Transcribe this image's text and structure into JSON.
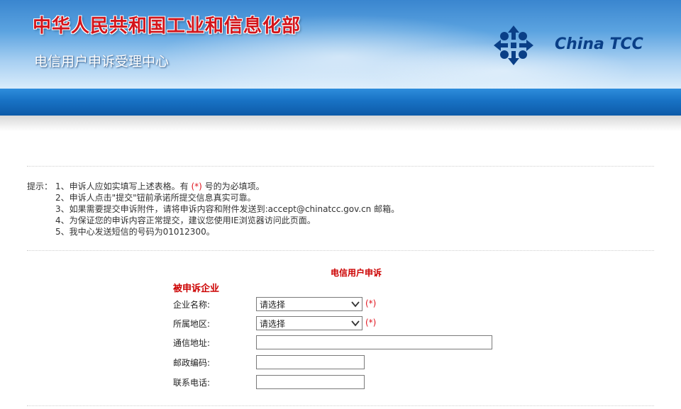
{
  "header": {
    "ministry_name": "中华人民共和国工业和信息化部",
    "center_name": "电信用户申诉受理中心",
    "logo_text": "China TCC",
    "logo_icon": "china-tcc-logo-icon"
  },
  "notes": {
    "label": "提示：",
    "items": [
      {
        "prefix": "1、申诉人应如实填写上述表格。有 ",
        "required_mark": "(*)",
        "suffix": " 号的为必填项。"
      },
      {
        "text": "2、申诉人点击\"提交\"钮前承诺所提交信息真实可靠。"
      },
      {
        "text": "3、如果需要提交申诉附件，请将申诉内容和附件发送到:accept@chinatcc.gov.cn 邮箱。"
      },
      {
        "text": "4、为保证您的申诉内容正常提交，建议您使用IE浏览器访问此页面。"
      },
      {
        "text": "5、我中心发送短信的号码为01012300。"
      }
    ]
  },
  "form": {
    "title": "电信用户申诉",
    "section_title": "被申诉企业",
    "required_mark": "(*)",
    "fields": {
      "company": {
        "label": "企业名称:",
        "value": "请选择"
      },
      "region": {
        "label": "所属地区:",
        "value": "请选择"
      },
      "address": {
        "label": "通信地址:",
        "value": ""
      },
      "postcode": {
        "label": "邮政编码:",
        "value": ""
      },
      "phone": {
        "label": "联系电话:",
        "value": ""
      }
    }
  },
  "colors": {
    "accent_red": "#cc0000",
    "banner_blue": "#1872c4",
    "logo_blue": "#0a3f87"
  }
}
